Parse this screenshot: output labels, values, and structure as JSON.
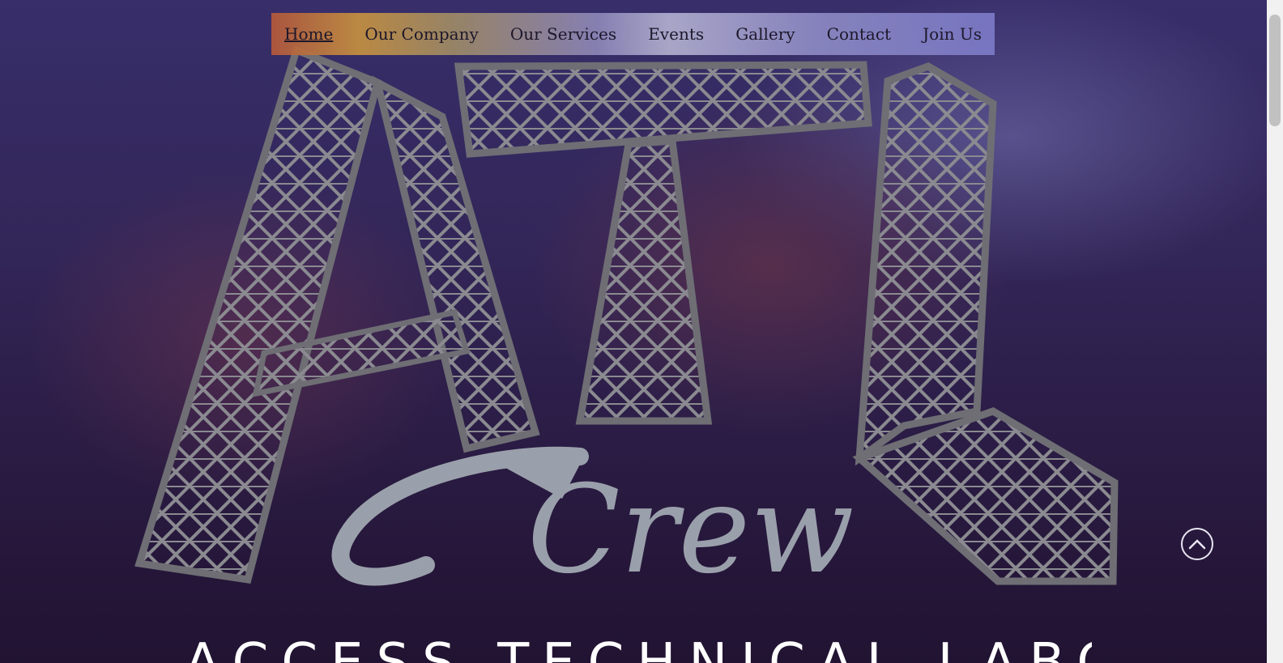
{
  "nav": {
    "items": [
      {
        "label": "Home",
        "active": true
      },
      {
        "label": "Our Company",
        "active": false
      },
      {
        "label": "Our Services",
        "active": false
      },
      {
        "label": "Events",
        "active": false
      },
      {
        "label": "Gallery",
        "active": false
      },
      {
        "label": "Contact",
        "active": false
      },
      {
        "label": "Join Us",
        "active": false
      }
    ]
  },
  "logo": {
    "word": "Crew",
    "icon": "truss-letters-logo"
  },
  "hero": {
    "headline": "ACCESS TECHNICAL LABOR"
  },
  "controls": {
    "scroll_top_icon": "chevron-up-icon"
  },
  "colors": {
    "truss": "#8a8a90",
    "crew_text": "#9aa0ab",
    "headline": "#ffffff"
  }
}
